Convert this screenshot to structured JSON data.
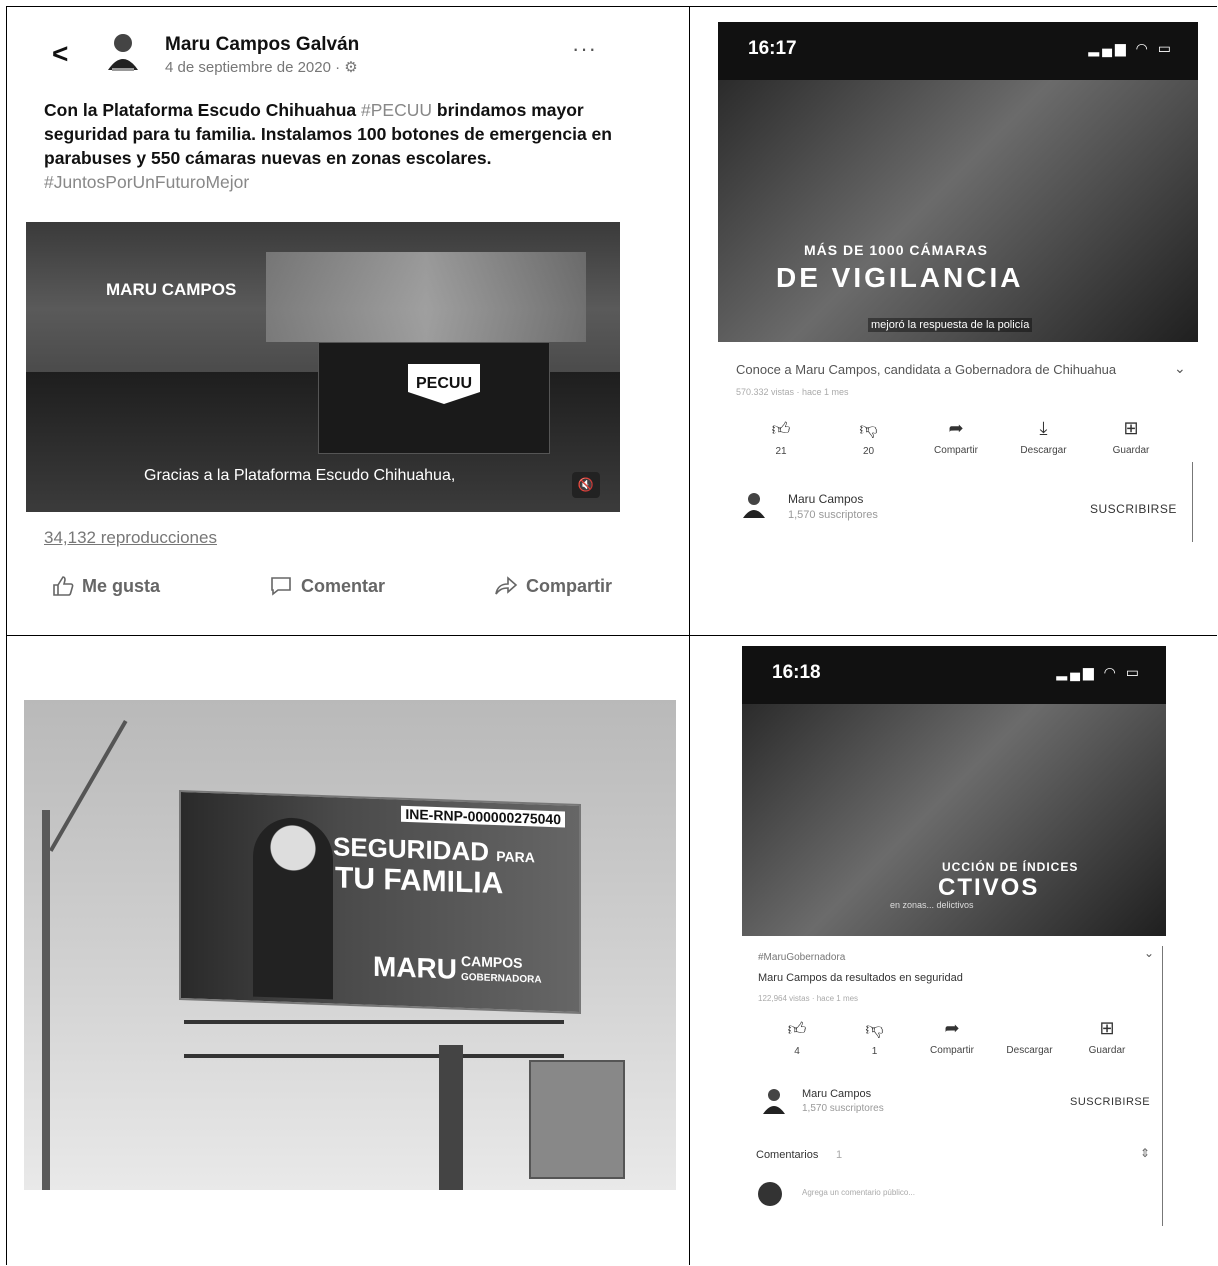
{
  "facebook_post": {
    "back": "<",
    "author": "Maru Campos Galván",
    "date": "4 de septiembre de 2020 · ⚙",
    "more": "···",
    "text_main": "Con la Plataforma Escudo Chihuahua",
    "text_tag1": "#PECUU",
    "text_rest": "brindamos mayor seguridad para tu familia. Instalamos 100 botones de emergencia en parabuses y 550 cámaras nuevas en zonas escolares.",
    "text_tag2": "#JuntosPorUnFuturoMejor",
    "video_title": "MARU CAMPOS",
    "video_logo": "PECUU",
    "video_caption": "Gracias a la Plataforma Escudo Chihuahua,",
    "views": "34,132 reproducciones",
    "actions": {
      "like": "Me gusta",
      "comment": "Comentar",
      "share": "Compartir"
    }
  },
  "youtube_1": {
    "time": "16:17",
    "overlay_line1": "MÁS DE 1000 CÁMARAS",
    "overlay_line2": "DE VIGILANCIA",
    "overlay_caption": "mejoró la respuesta de la policía",
    "title": "Conoce a Maru Campos, candidata a Gobernadora de Chihuahua",
    "meta": "570.332 vistas · hace 1 mes",
    "actions": {
      "like_count": "21",
      "dislike_count": "20",
      "share": "Compartir",
      "download": "Descargar",
      "save": "Guardar"
    },
    "channel": "Maru Campos",
    "subscribers": "1,570 suscriptores",
    "subscribe": "SUSCRIBIRSE"
  },
  "billboard": {
    "registration": "INE-RNP-000000275040",
    "line1": "SEGURIDAD",
    "line1_small": "PARA",
    "line2": "TU FAMILIA",
    "logo_name": "MARU",
    "logo_surname": "CAMPOS",
    "logo_role": "GOBERNADORA"
  },
  "youtube_2": {
    "time": "16:18",
    "overlay_line1": "UCCIÓN DE ÍNDICES",
    "overlay_line2": "CTIVOS",
    "overlay_caption": "en zonas... delictivos",
    "hashtag": "#MaruGobernadora",
    "title": "Maru Campos da resultados en seguridad",
    "meta": "122,964 vistas · hace 1 mes",
    "actions": {
      "like_count": "4",
      "dislike_count": "1",
      "share": "Compartir",
      "download": "Descargar",
      "save": "Guardar"
    },
    "channel": "Maru Campos",
    "subscribers": "1,570 suscriptores",
    "subscribe": "SUSCRIBIRSE",
    "comments_label": "Comentarios",
    "comments_count": "1",
    "comment_placeholder": "Agrega un comentario público..."
  }
}
